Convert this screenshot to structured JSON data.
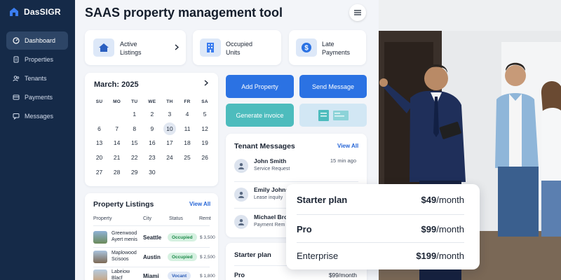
{
  "brand": {
    "name": "DasSIGR"
  },
  "sidebar": {
    "items": [
      {
        "label": "Dashboard",
        "icon": "dashboard-icon",
        "active": true
      },
      {
        "label": "Properties",
        "icon": "document-icon"
      },
      {
        "label": "Tenants",
        "icon": "users-icon"
      },
      {
        "label": "Payments",
        "icon": "card-icon"
      },
      {
        "label": "Messages",
        "icon": "chat-icon"
      }
    ]
  },
  "header": {
    "title": "SAAS property management tool"
  },
  "stats": [
    {
      "label": "Active\nListings",
      "icon": "house-icon"
    },
    {
      "label": "Occupied\nUnits",
      "icon": "building-icon"
    },
    {
      "label": "Late\nPayments",
      "icon": "dollar-icon"
    }
  ],
  "calendar": {
    "month": "March",
    "year": "2025",
    "weekdays": [
      "SU",
      "MO",
      "TU",
      "WE",
      "TH",
      "FR",
      "SA"
    ],
    "weeks": [
      [
        "",
        "",
        "1",
        "2",
        "3",
        "4",
        "5"
      ],
      [
        "6",
        "7",
        "8",
        "9",
        "10",
        "11",
        "12"
      ],
      [
        "13",
        "14",
        "15",
        "16",
        "17",
        "18",
        "19"
      ],
      [
        "20",
        "21",
        "22",
        "23",
        "24",
        "25",
        "26"
      ],
      [
        "27",
        "28",
        "29",
        "30",
        "",
        "",
        ""
      ]
    ],
    "highlighted": "10"
  },
  "listings": {
    "title": "Property Listings",
    "view_all": "View All",
    "columns": [
      "Property",
      "City",
      "Status",
      "Remt"
    ],
    "rows": [
      {
        "name": "Greenwood\nAyert menis",
        "city": "Seattle",
        "status": "Occupied",
        "rent": "$ 3,500"
      },
      {
        "name": "Maplowood\nScisoos",
        "city": "Austin",
        "status": "Occupied",
        "rent": "$ 2,500"
      },
      {
        "name": "Labeiow\nBlacf",
        "city": "Miami",
        "status": "Vocant",
        "rent": "$ 1,800"
      }
    ]
  },
  "actions": {
    "add_property": "Add Property",
    "send_message": "Send Message",
    "generate_invoice": "Generate invoice"
  },
  "messages": {
    "title": "Tenant Messages",
    "view_all": "View All",
    "items": [
      {
        "name": "John Smith",
        "sub": "Service Request",
        "time": "15 min ago"
      },
      {
        "name": "Emily Johnso",
        "sub": "Lease inquity",
        "time": ""
      },
      {
        "name": "Michael Brov",
        "sub": "Payment Rem",
        "time": ""
      }
    ]
  },
  "mini_plans": [
    {
      "name": "Starter plan",
      "price": ""
    },
    {
      "name": "Pro",
      "price": "$99/month"
    }
  ],
  "pricing": [
    {
      "name": "Starter plan",
      "amount": "$49",
      "period": "/month"
    },
    {
      "name": "Pro",
      "amount": "$99",
      "period": "/month"
    },
    {
      "name": "Enterprise",
      "amount": "$199",
      "period": "/month"
    }
  ],
  "colors": {
    "sidebar": "#152a48",
    "accent": "#2b72e3",
    "teal": "#4dbcbd"
  }
}
